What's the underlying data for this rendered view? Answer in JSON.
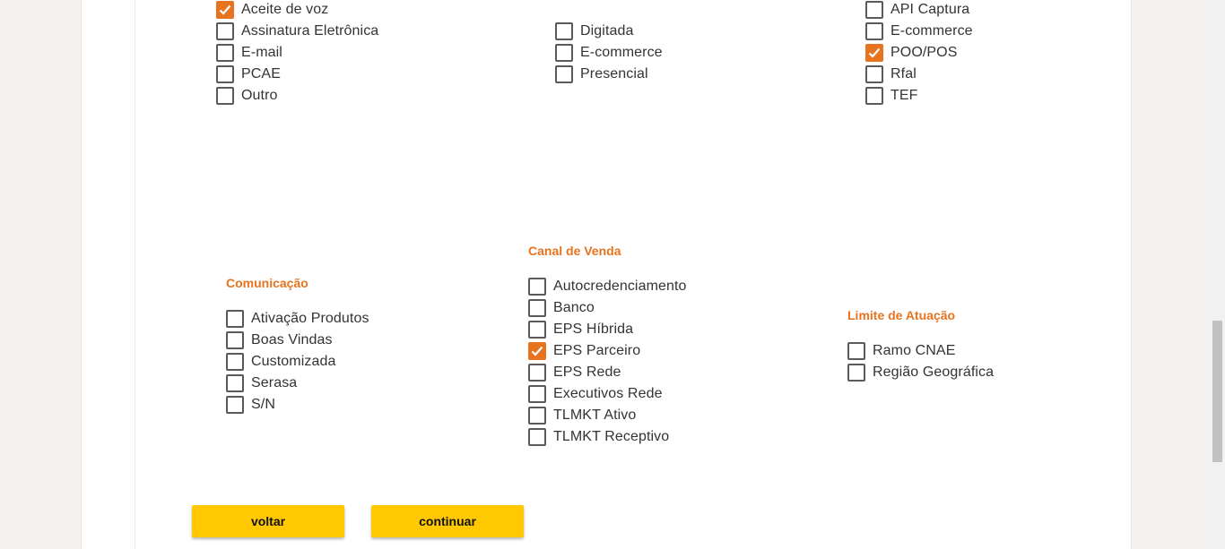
{
  "groups": {
    "g1": {
      "options": [
        {
          "label": "Aceite de voz",
          "checked": true
        },
        {
          "label": "Assinatura Eletrônica",
          "checked": false
        },
        {
          "label": "E-mail",
          "checked": false
        },
        {
          "label": "PCAE",
          "checked": false
        },
        {
          "label": "Outro",
          "checked": false
        }
      ]
    },
    "g2": {
      "options": [
        {
          "label": "Digitada",
          "checked": false
        },
        {
          "label": "E-commerce",
          "checked": false
        },
        {
          "label": "Presencial",
          "checked": false
        }
      ]
    },
    "g3": {
      "options": [
        {
          "label": "API Captura",
          "checked": false
        },
        {
          "label": "E-commerce",
          "checked": false
        },
        {
          "label": "POO/POS",
          "checked": true
        },
        {
          "label": "Rfal",
          "checked": false
        },
        {
          "label": "TEF",
          "checked": false
        }
      ]
    },
    "comunicacao": {
      "title": "Comunicação",
      "options": [
        {
          "label": "Ativação Produtos",
          "checked": false
        },
        {
          "label": "Boas Vindas",
          "checked": false
        },
        {
          "label": "Customizada",
          "checked": false
        },
        {
          "label": "Serasa",
          "checked": false
        },
        {
          "label": "S/N",
          "checked": false
        }
      ]
    },
    "canal": {
      "title": "Canal de Venda",
      "options": [
        {
          "label": "Autocredenciamento",
          "checked": false
        },
        {
          "label": "Banco",
          "checked": false
        },
        {
          "label": "EPS Híbrida",
          "checked": false
        },
        {
          "label": "EPS Parceiro",
          "checked": true
        },
        {
          "label": "EPS Rede",
          "checked": false
        },
        {
          "label": "Executivos Rede",
          "checked": false
        },
        {
          "label": "TLMKT Ativo",
          "checked": false
        },
        {
          "label": "TLMKT Receptivo",
          "checked": false
        }
      ]
    },
    "limite": {
      "title": "Limite de Atuação",
      "options": [
        {
          "label": "Ramo CNAE",
          "checked": false
        },
        {
          "label": "Região Geográfica",
          "checked": false
        }
      ]
    }
  },
  "buttons": {
    "back": "voltar",
    "next": "continuar"
  },
  "colors": {
    "accent": "#e8731e",
    "button": "#ffc800",
    "page_bg": "#f4f1ef"
  }
}
